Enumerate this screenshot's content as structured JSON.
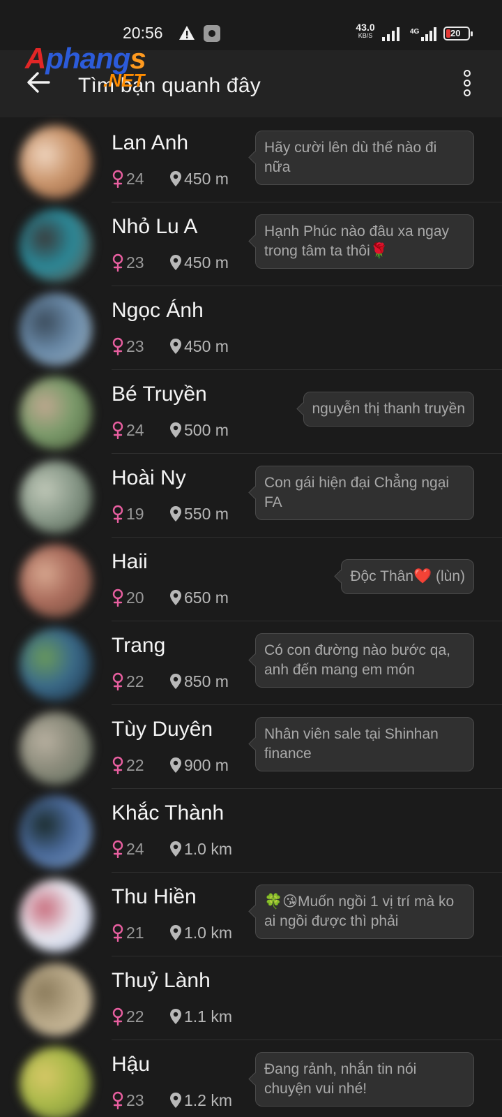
{
  "status_bar": {
    "time": "20:56",
    "net_speed_value": "43.0",
    "net_speed_unit": "KB/S",
    "battery_level": "20",
    "battery_fraction": 0.2,
    "icons": [
      "warning-icon",
      "settings-notification-icon",
      "signal-icon",
      "4g-signal-icon",
      "battery-icon"
    ]
  },
  "header": {
    "title": "Tìm bạn quanh đây",
    "back_icon": "arrow-left-icon",
    "menu_icon": "more-vertical-icon"
  },
  "watermark": {
    "text_a": "A",
    "text_b": "phang",
    "text_c": "s",
    "text_net": ".NET"
  },
  "colors": {
    "background": "#1b1b1b",
    "app_bar": "#232323",
    "female_accent": "#e85fa0",
    "bubble_bg": "#303030",
    "bubble_border": "#4a4a4a"
  },
  "people": [
    {
      "name": "Lan Anh",
      "age": "24",
      "distance": "450 m",
      "status": "Hãy cười lên dù thế nào đi nữa",
      "avatar": [
        "#c8936a",
        "#f0d6c0",
        "#8a5a3c"
      ]
    },
    {
      "name": "Nhỏ Lu A",
      "age": "23",
      "distance": "450 m",
      "status": "Hạnh Phúc nào đâu xa ngay trong tâm ta thôi🌹",
      "avatar": [
        "#2a8a9a",
        "#3a3a3a",
        "#6b4a3a"
      ]
    },
    {
      "name": "Ngọc Ánh",
      "age": "23",
      "distance": "450 m",
      "status": "",
      "avatar": [
        "#6a8aa8",
        "#3a4a5a",
        "#9ab0c0"
      ]
    },
    {
      "name": "Bé Truyền",
      "age": "24",
      "distance": "500 m",
      "status": "nguyễn thị thanh truyền",
      "avatar": [
        "#7a9a6a",
        "#c0a890",
        "#4a5a3a"
      ]
    },
    {
      "name": "Hoài Ny",
      "age": "19",
      "distance": "550 m",
      "status": "Con gái hiện đại Chẳng ngại FA",
      "avatar": [
        "#8a9a8a",
        "#c0c8b8",
        "#4a5a4a"
      ]
    },
    {
      "name": "Haii",
      "age": "20",
      "distance": "650 m",
      "status": "Độc Thân❤️ (lùn)",
      "avatar": [
        "#a86a5a",
        "#d8a890",
        "#6a4a3a"
      ]
    },
    {
      "name": "Trang",
      "age": "22",
      "distance": "850 m",
      "status": "Có con đường nào bước qa, anh đến mang em món",
      "avatar": [
        "#3a6a8a",
        "#6a9a5a",
        "#1a2a3a"
      ]
    },
    {
      "name": "Tùy Duyên",
      "age": "22",
      "distance": "900 m",
      "status": "Nhân viên sale tại Shinhan finance",
      "avatar": [
        "#8a8a7a",
        "#b8b0a0",
        "#5a6a5a"
      ]
    },
    {
      "name": "Khắc Thành",
      "age": "24",
      "distance": "1.0 km",
      "status": "",
      "avatar": [
        "#4a6a9a",
        "#1a2a2a",
        "#7a9ac0"
      ]
    },
    {
      "name": "Thu Hiền",
      "age": "21",
      "distance": "1.0 km",
      "status": "🍀😘Muốn ngồi 1 vị trí mà ko ai ngồi được thì phải",
      "avatar": [
        "#e8e8f0",
        "#c86a7a",
        "#a8b8d8"
      ]
    },
    {
      "name": "Thuỷ Lành",
      "age": "22",
      "distance": "1.1 km",
      "status": "",
      "avatar": [
        "#b8a888",
        "#8a7a5a",
        "#d8c8a8"
      ]
    },
    {
      "name": "Hậu",
      "age": "23",
      "distance": "1.2 km",
      "status": "Đang rảnh, nhắn tin nói chuyện vui nhé!",
      "avatar": [
        "#a8b848",
        "#d8c868",
        "#6a7a3a"
      ]
    }
  ]
}
